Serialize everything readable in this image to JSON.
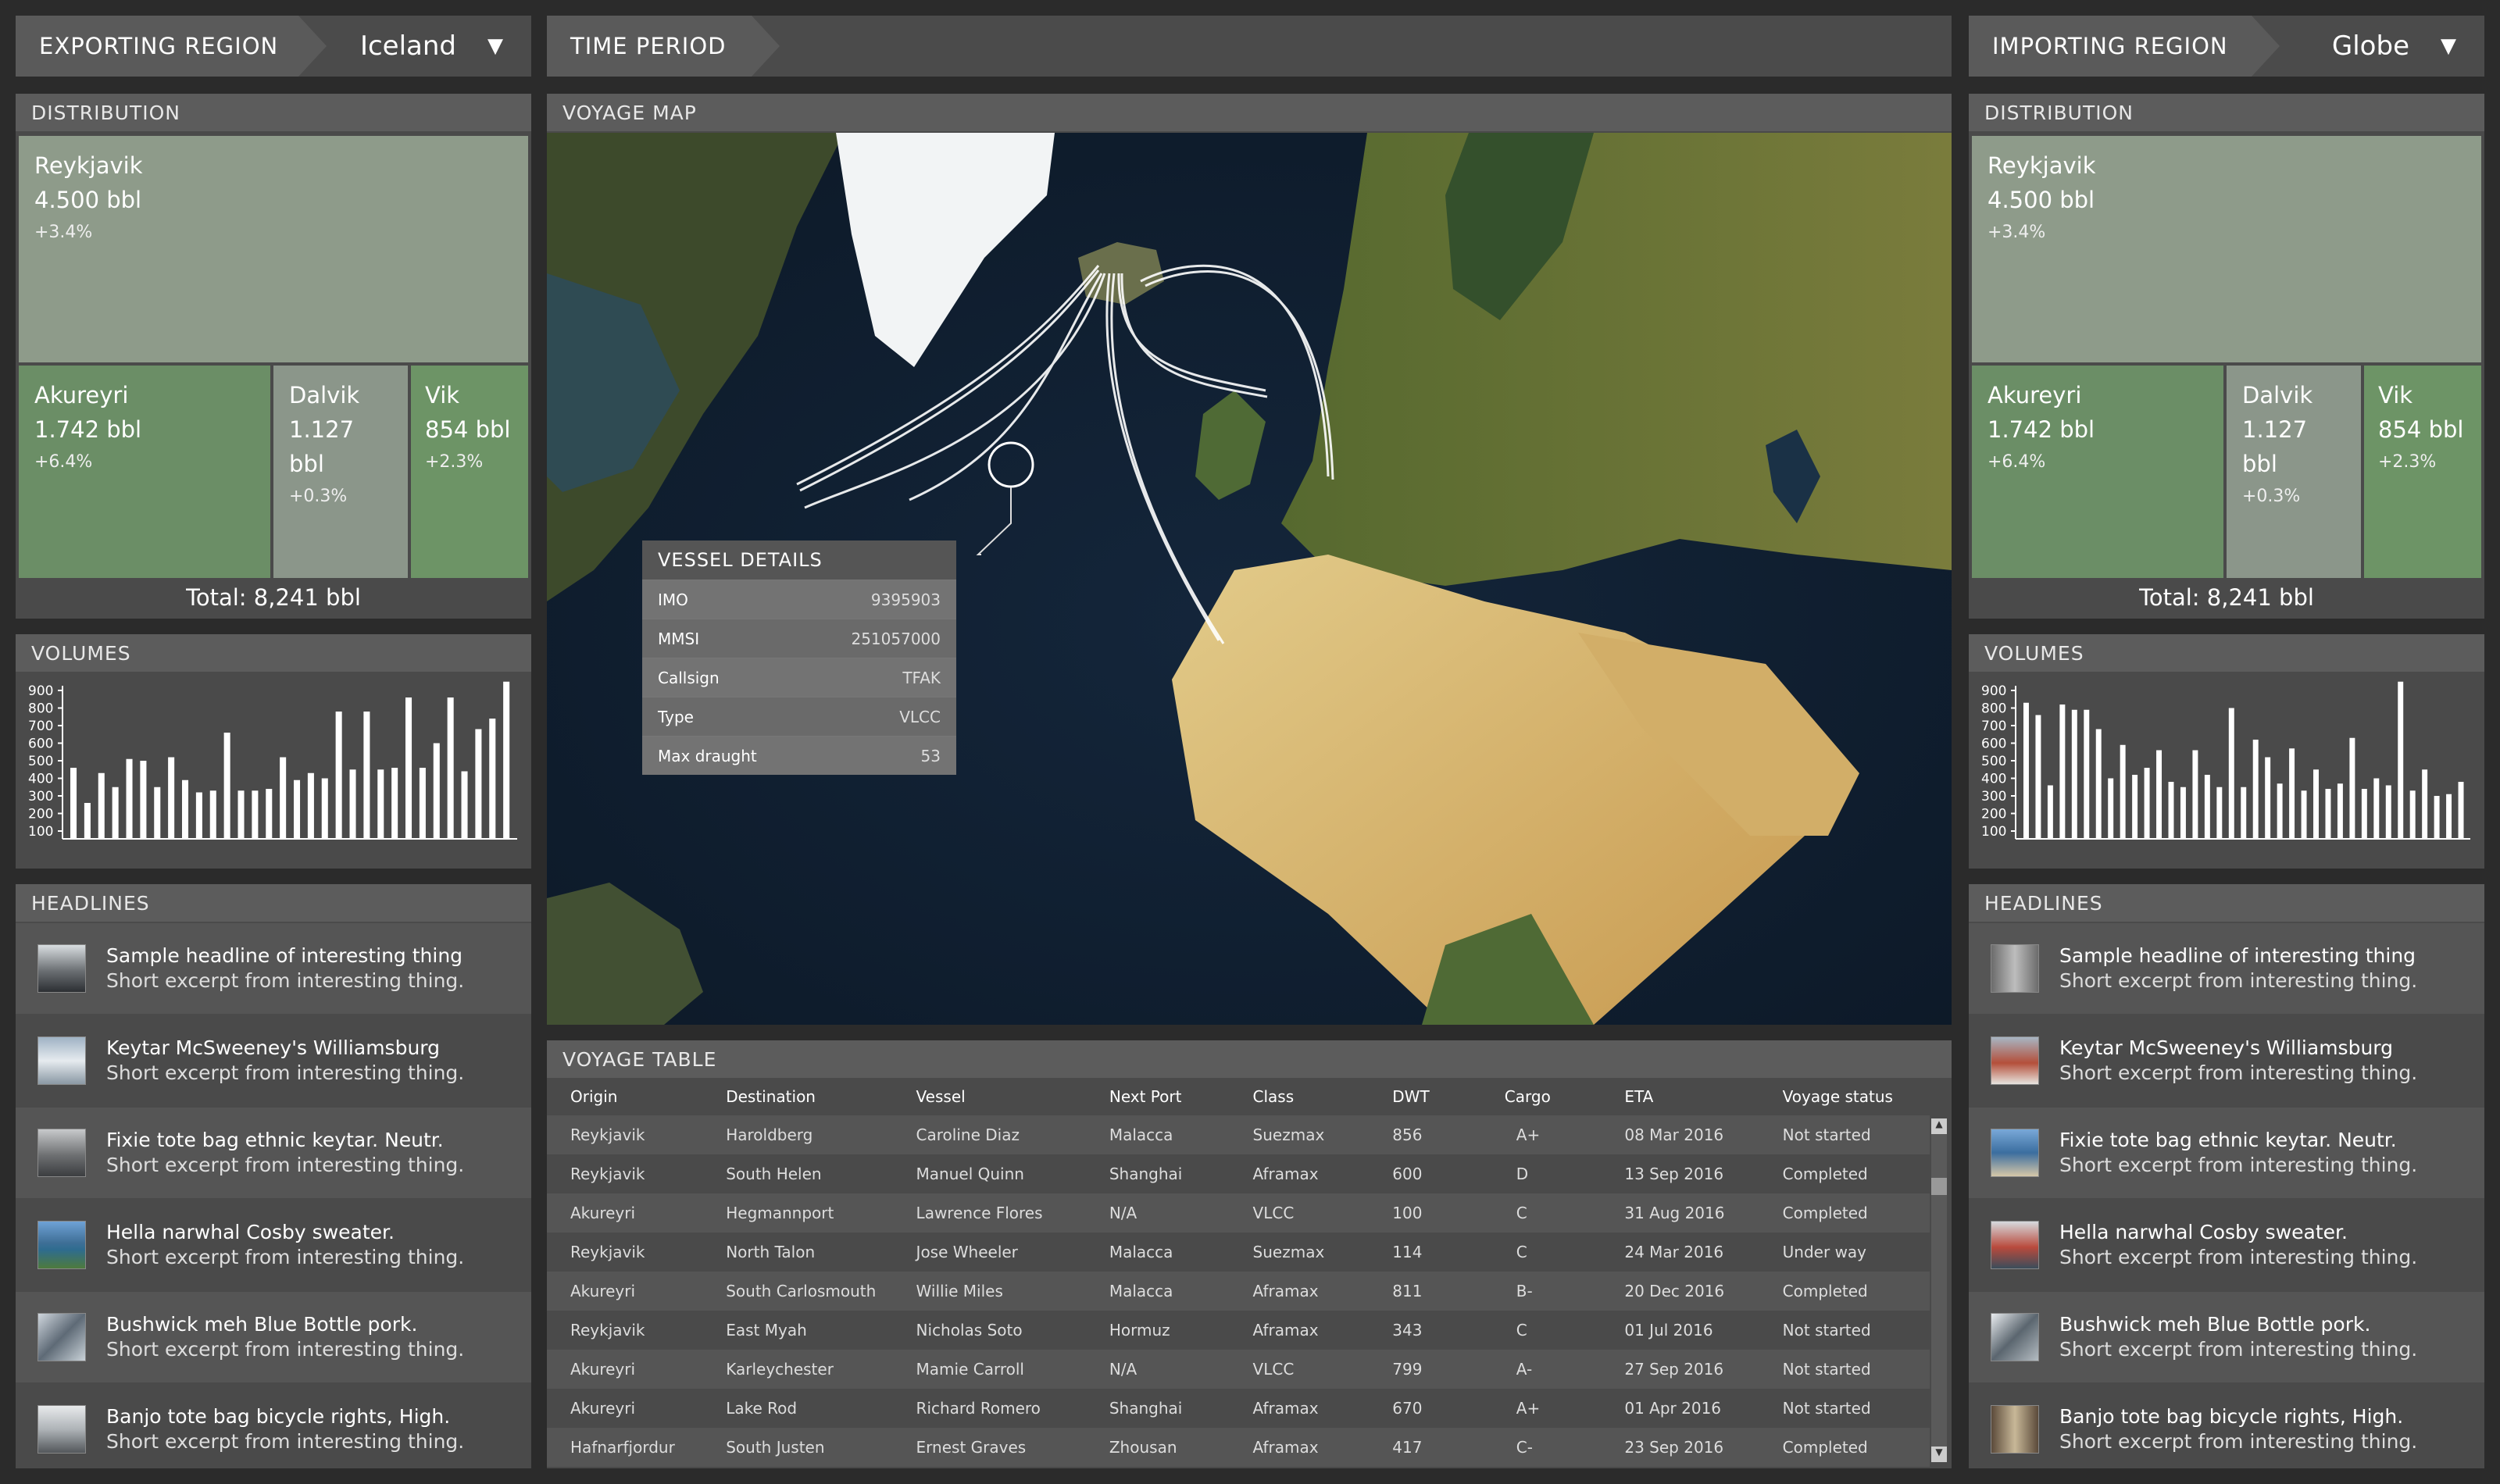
{
  "export_bar": {
    "label": "EXPORTING REGION",
    "value": "Iceland",
    "arrow": "▼"
  },
  "time_bar": {
    "label": "TIME PERIOD"
  },
  "import_bar": {
    "label": "IMPORTING REGION",
    "value": "Globe",
    "arrow": "▼"
  },
  "left": {
    "distribution": {
      "title": "DISTRIBUTION",
      "tiles": [
        {
          "name": "Reykjavik",
          "value": "4.500 bbl",
          "change": "+3.4%"
        },
        {
          "name": "Akureyri",
          "value": "1.742 bbl",
          "change": "+6.4%"
        },
        {
          "name": "Dalvik",
          "value": "1.127 bbl",
          "change": "+0.3%"
        },
        {
          "name": "Vik",
          "value": "854 bbl",
          "change": "+2.3%"
        }
      ],
      "total_label": "Total:",
      "total_value": "8,241 bbl"
    },
    "volumes": {
      "title": "VOLUMES",
      "chart_data": {
        "type": "bar",
        "yticks": [
          "900",
          "800",
          "700",
          "600",
          "500",
          "400",
          "300",
          "200",
          "100"
        ],
        "ylim": [
          100,
          900
        ],
        "values": [
          460,
          260,
          430,
          350,
          510,
          500,
          350,
          520,
          390,
          320,
          330,
          660,
          330,
          330,
          340,
          520,
          390,
          430,
          400,
          780,
          450,
          780,
          450,
          460,
          860,
          460,
          600,
          860,
          440,
          680,
          740,
          950
        ]
      }
    },
    "headlines": {
      "title": "HEADLINES",
      "items": [
        {
          "title": "Sample headline of interesting thing",
          "excerpt": "Short excerpt from interesting thing."
        },
        {
          "title": "Keytar McSweeney's Williamsburg",
          "excerpt": "Short excerpt from interesting thing."
        },
        {
          "title": "Fixie tote bag ethnic keytar. Neutr.",
          "excerpt": "Short excerpt from interesting thing."
        },
        {
          "title": "Hella narwhal Cosby sweater.",
          "excerpt": "Short excerpt from interesting thing."
        },
        {
          "title": "Bushwick meh Blue Bottle pork.",
          "excerpt": "Short excerpt from interesting thing."
        },
        {
          "title": "Banjo tote bag bicycle rights, High.",
          "excerpt": "Short excerpt from interesting thing."
        }
      ]
    }
  },
  "right": {
    "distribution": {
      "title": "DISTRIBUTION",
      "tiles": [
        {
          "name": "Reykjavik",
          "value": "4.500 bbl",
          "change": "+3.4%"
        },
        {
          "name": "Akureyri",
          "value": "1.742 bbl",
          "change": "+6.4%"
        },
        {
          "name": "Dalvik",
          "value": "1.127 bbl",
          "change": "+0.3%"
        },
        {
          "name": "Vik",
          "value": "854 bbl",
          "change": "+2.3%"
        }
      ],
      "total_label": "Total:",
      "total_value": "8,241 bbl"
    },
    "volumes": {
      "title": "VOLUMES",
      "chart_data": {
        "type": "bar",
        "yticks": [
          "900",
          "800",
          "700",
          "600",
          "500",
          "400",
          "300",
          "200",
          "100"
        ],
        "ylim": [
          100,
          900
        ],
        "values": [
          830,
          760,
          360,
          820,
          790,
          790,
          680,
          400,
          590,
          420,
          460,
          560,
          380,
          350,
          560,
          420,
          350,
          800,
          350,
          620,
          520,
          370,
          570,
          330,
          450,
          340,
          370,
          630,
          340,
          400,
          360,
          950,
          330,
          450,
          300,
          310,
          380
        ]
      }
    },
    "headlines": {
      "title": "HEADLINES",
      "items": [
        {
          "title": "Sample headline of interesting thing",
          "excerpt": "Short excerpt from interesting thing."
        },
        {
          "title": "Keytar McSweeney's Williamsburg",
          "excerpt": "Short excerpt from interesting thing."
        },
        {
          "title": "Fixie tote bag ethnic keytar. Neutr.",
          "excerpt": "Short excerpt from interesting thing."
        },
        {
          "title": "Hella narwhal Cosby sweater.",
          "excerpt": "Short excerpt from interesting thing."
        },
        {
          "title": "Bushwick meh Blue Bottle pork.",
          "excerpt": "Short excerpt from interesting thing."
        },
        {
          "title": "Banjo tote bag bicycle rights, High.",
          "excerpt": "Short excerpt from interesting thing."
        }
      ]
    }
  },
  "map": {
    "title": "VOYAGE MAP",
    "vessel": {
      "title": "VESSEL DETAILS",
      "rows": [
        {
          "k": "IMO",
          "v": "9395903"
        },
        {
          "k": "MMSI",
          "v": "251057000"
        },
        {
          "k": "Callsign",
          "v": "TFAK"
        },
        {
          "k": "Type",
          "v": "VLCC"
        },
        {
          "k": "Max draught",
          "v": "53"
        }
      ]
    }
  },
  "table": {
    "title": "VOYAGE TABLE",
    "columns": [
      "Origin",
      "Destination",
      "Vessel",
      "Next Port",
      "Class",
      "DWT",
      "Cargo",
      "ETA",
      "Voyage status"
    ],
    "rows": [
      [
        "Reykjavik",
        "Haroldberg",
        "Caroline Diaz",
        "Malacca",
        "Suezmax",
        "856",
        "A+",
        "08 Mar 2016",
        "Not started"
      ],
      [
        "Reykjavik",
        "South Helen",
        "Manuel Quinn",
        "Shanghai",
        "Aframax",
        "600",
        "D",
        "13 Sep 2016",
        "Completed"
      ],
      [
        "Akureyri",
        "Hegmannport",
        "Lawrence Flores",
        "N/A",
        "VLCC",
        "100",
        "C",
        "31 Aug 2016",
        "Completed"
      ],
      [
        "Reykjavik",
        "North Talon",
        "Jose Wheeler",
        "Malacca",
        "Suezmax",
        "114",
        "C",
        "24 Mar 2016",
        "Under way"
      ],
      [
        "Akureyri",
        "South Carlosmouth",
        "Willie Miles",
        "Malacca",
        "Aframax",
        "811",
        "B-",
        "20 Dec 2016",
        "Completed"
      ],
      [
        "Reykjavik",
        "East Myah",
        "Nicholas Soto",
        "Hormuz",
        "Aframax",
        "343",
        "C",
        "01 Jul 2016",
        "Not started"
      ],
      [
        "Akureyri",
        "Karleychester",
        "Mamie Carroll",
        "N/A",
        "VLCC",
        "799",
        "A-",
        "27 Sep 2016",
        "Not started"
      ],
      [
        "Akureyri",
        "Lake Rod",
        "Richard Romero",
        "Shanghai",
        "Aframax",
        "670",
        "A+",
        "01 Apr 2016",
        "Not started"
      ],
      [
        "Hafnarfjordur",
        "South Justen",
        "Ernest Graves",
        "Zhousan",
        "Aframax",
        "417",
        "C-",
        "23 Sep 2016",
        "Completed"
      ]
    ]
  },
  "colors": {
    "tile_big": "#8e9b8a",
    "tile_green": "#6b8e66",
    "tile_gray": "#8b968a",
    "tile_vik": "#6d9466"
  }
}
